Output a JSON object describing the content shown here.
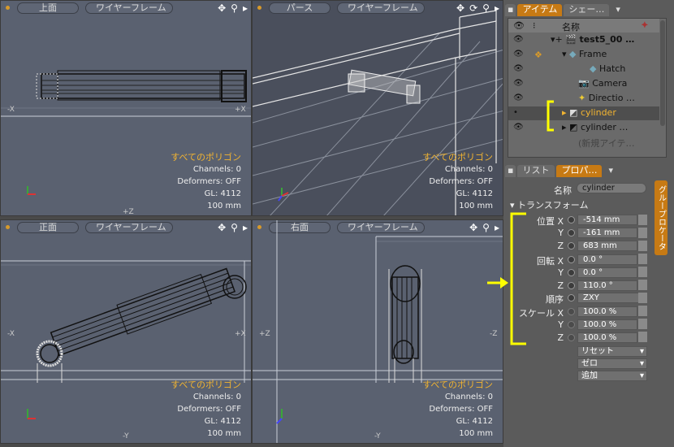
{
  "viewports": {
    "top": {
      "view": "上面",
      "mode": "ワイヤーフレーム",
      "axis_left": "-X",
      "axis_right": "+X",
      "axis_bottom": "+Z"
    },
    "persp": {
      "view": "パース",
      "mode": "ワイヤーフレーム"
    },
    "front": {
      "view": "正面",
      "mode": "ワイヤーフレーム",
      "axis_left": "-X",
      "axis_right": "+X",
      "axis_bottom": "-Y"
    },
    "right": {
      "view": "右面",
      "mode": "ワイヤーフレーム",
      "axis_left": "+Z",
      "axis_right": "-Z",
      "axis_bottom": "-Y"
    }
  },
  "stats": {
    "polys": "すべてのポリゴン",
    "channels": "Channels: 0",
    "deformers": "Deformers: OFF",
    "gl": "GL: 4112",
    "scale": "100 mm"
  },
  "items_tabs": {
    "tab1": "アイテム",
    "tab2": "シェー…"
  },
  "tree": {
    "header_name": "名称",
    "rows": [
      {
        "label": "test5_00 …"
      },
      {
        "label": "Frame"
      },
      {
        "label": "Hatch"
      },
      {
        "label": "Camera"
      },
      {
        "label": "Directio …"
      },
      {
        "label": "cylinder"
      },
      {
        "label": "cylinder …"
      },
      {
        "label": "(新規アイテ…"
      }
    ]
  },
  "props_tabs": {
    "tab1": "リスト",
    "tab2": "プロパ…"
  },
  "properties": {
    "name_label": "名称",
    "name_value": "cylinder",
    "transform_header": "トランスフォーム",
    "pos_label": "位置",
    "rot_label": "回転",
    "order_label": "順序",
    "scale_label": "スケール",
    "x": "X",
    "y": "Y",
    "z": "Z",
    "pos_x": "-514 mm",
    "pos_y": "-161 mm",
    "pos_z": "683 mm",
    "rot_x": "0.0 °",
    "rot_y": "0.0 °",
    "rot_z": "110.0 °",
    "order": "ZXY",
    "scale_x": "100.0 %",
    "scale_y": "100.0 %",
    "scale_z": "100.0 %",
    "reset": "リセット",
    "zero": "ゼロ",
    "add": "追加",
    "side_tab": "グループロケータ"
  },
  "colors": {
    "accent": "#c77a14",
    "annotation": "#ffff00",
    "highlight_text": "#f2b431"
  }
}
